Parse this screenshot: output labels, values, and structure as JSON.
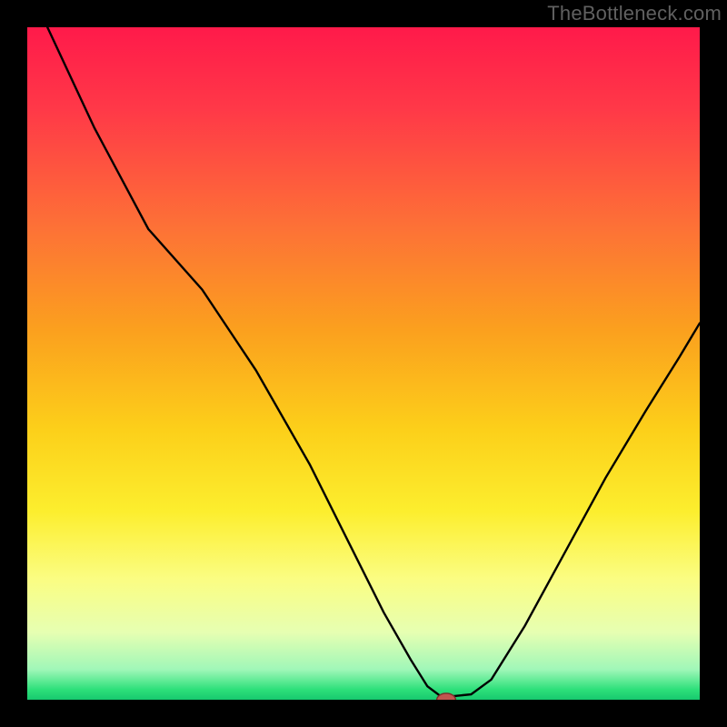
{
  "watermark": "TheBottleneck.com",
  "chart_data": {
    "type": "line",
    "title": "",
    "xlabel": "",
    "ylabel": "",
    "xlim": [
      0,
      100
    ],
    "ylim": [
      0,
      100
    ],
    "background_gradient": {
      "stops": [
        {
          "offset": 0.0,
          "color": "#ff1a4a"
        },
        {
          "offset": 0.12,
          "color": "#ff3848"
        },
        {
          "offset": 0.3,
          "color": "#fd7236"
        },
        {
          "offset": 0.45,
          "color": "#fba01e"
        },
        {
          "offset": 0.6,
          "color": "#fcd01a"
        },
        {
          "offset": 0.72,
          "color": "#fcee2e"
        },
        {
          "offset": 0.82,
          "color": "#fbfd82"
        },
        {
          "offset": 0.9,
          "color": "#e6ffb2"
        },
        {
          "offset": 0.955,
          "color": "#a0f7b8"
        },
        {
          "offset": 0.985,
          "color": "#2de07a"
        },
        {
          "offset": 1.0,
          "color": "#17c96f"
        }
      ]
    },
    "series": [
      {
        "name": "bottleneck-curve",
        "color": "#000000",
        "width": 2.4,
        "x": [
          3,
          10,
          18,
          26,
          34,
          42,
          48,
          53,
          57,
          59.5,
          61.5,
          63,
          66,
          69,
          74,
          80,
          86,
          92,
          97,
          100
        ],
        "y": [
          100,
          85,
          70,
          61,
          49,
          35,
          23,
          13,
          6,
          2,
          0.5,
          0.5,
          0.8,
          3,
          11,
          22,
          33,
          43,
          51,
          56
        ]
      }
    ],
    "marker": {
      "name": "optimal-point",
      "x": 62.3,
      "y": 0,
      "rx": 1.4,
      "ry": 0.95,
      "fill": "#c1554f",
      "stroke": "#7a2e2a"
    }
  }
}
